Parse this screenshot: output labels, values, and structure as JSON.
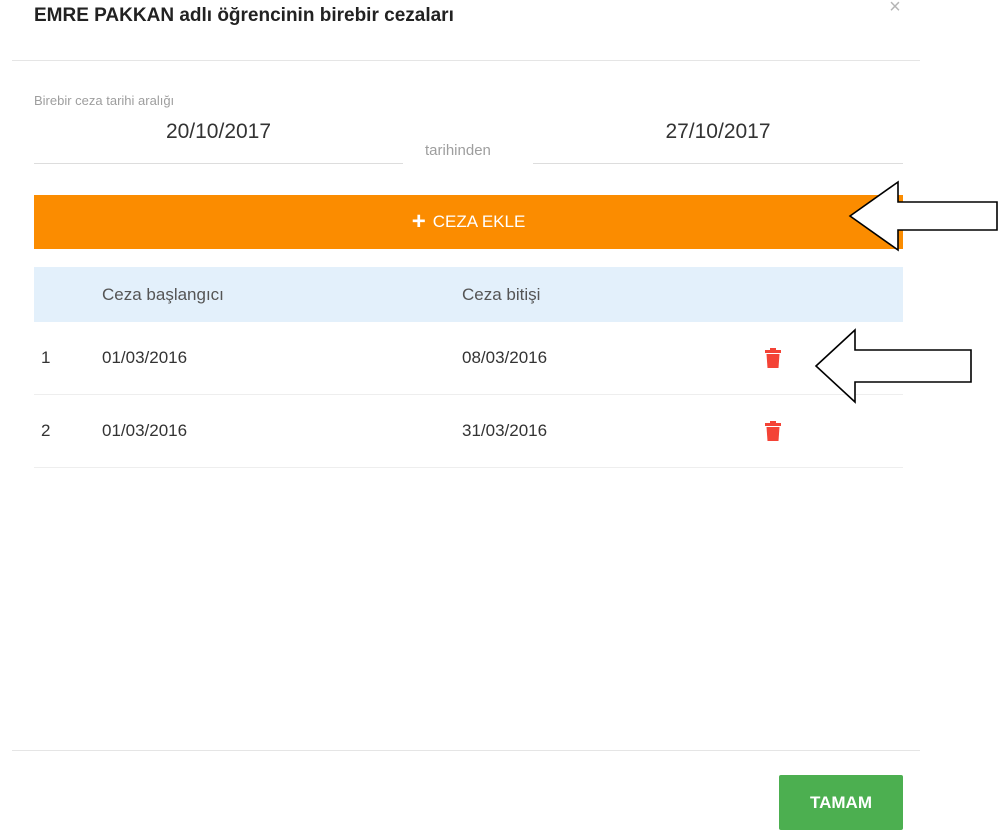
{
  "modal": {
    "title": "EMRE PAKKAN adlı öğrencinin birebir cezaları",
    "close_label": "×"
  },
  "date_range": {
    "label": "Birebir ceza tarihi aralığı",
    "start": "20/10/2017",
    "middle_text": "tarihinden",
    "end": "27/10/2017"
  },
  "add_button": {
    "icon": "plus-icon",
    "plus": "+",
    "label": "CEZA EKLE"
  },
  "table": {
    "headers": [
      "",
      "Ceza başlangıcı",
      "Ceza bitişi"
    ],
    "rows": [
      {
        "index": "1",
        "start": "01/03/2016",
        "end": "08/03/2016",
        "action_icon": "trash-icon"
      },
      {
        "index": "2",
        "start": "01/03/2016",
        "end": "31/03/2016",
        "action_icon": "trash-icon"
      }
    ]
  },
  "footer": {
    "ok_label": "TAMAM"
  },
  "colors": {
    "accent_orange": "#fb8c00",
    "header_blue": "#e3f0fb",
    "delete_red": "#f44336",
    "ok_green": "#4caf50"
  }
}
